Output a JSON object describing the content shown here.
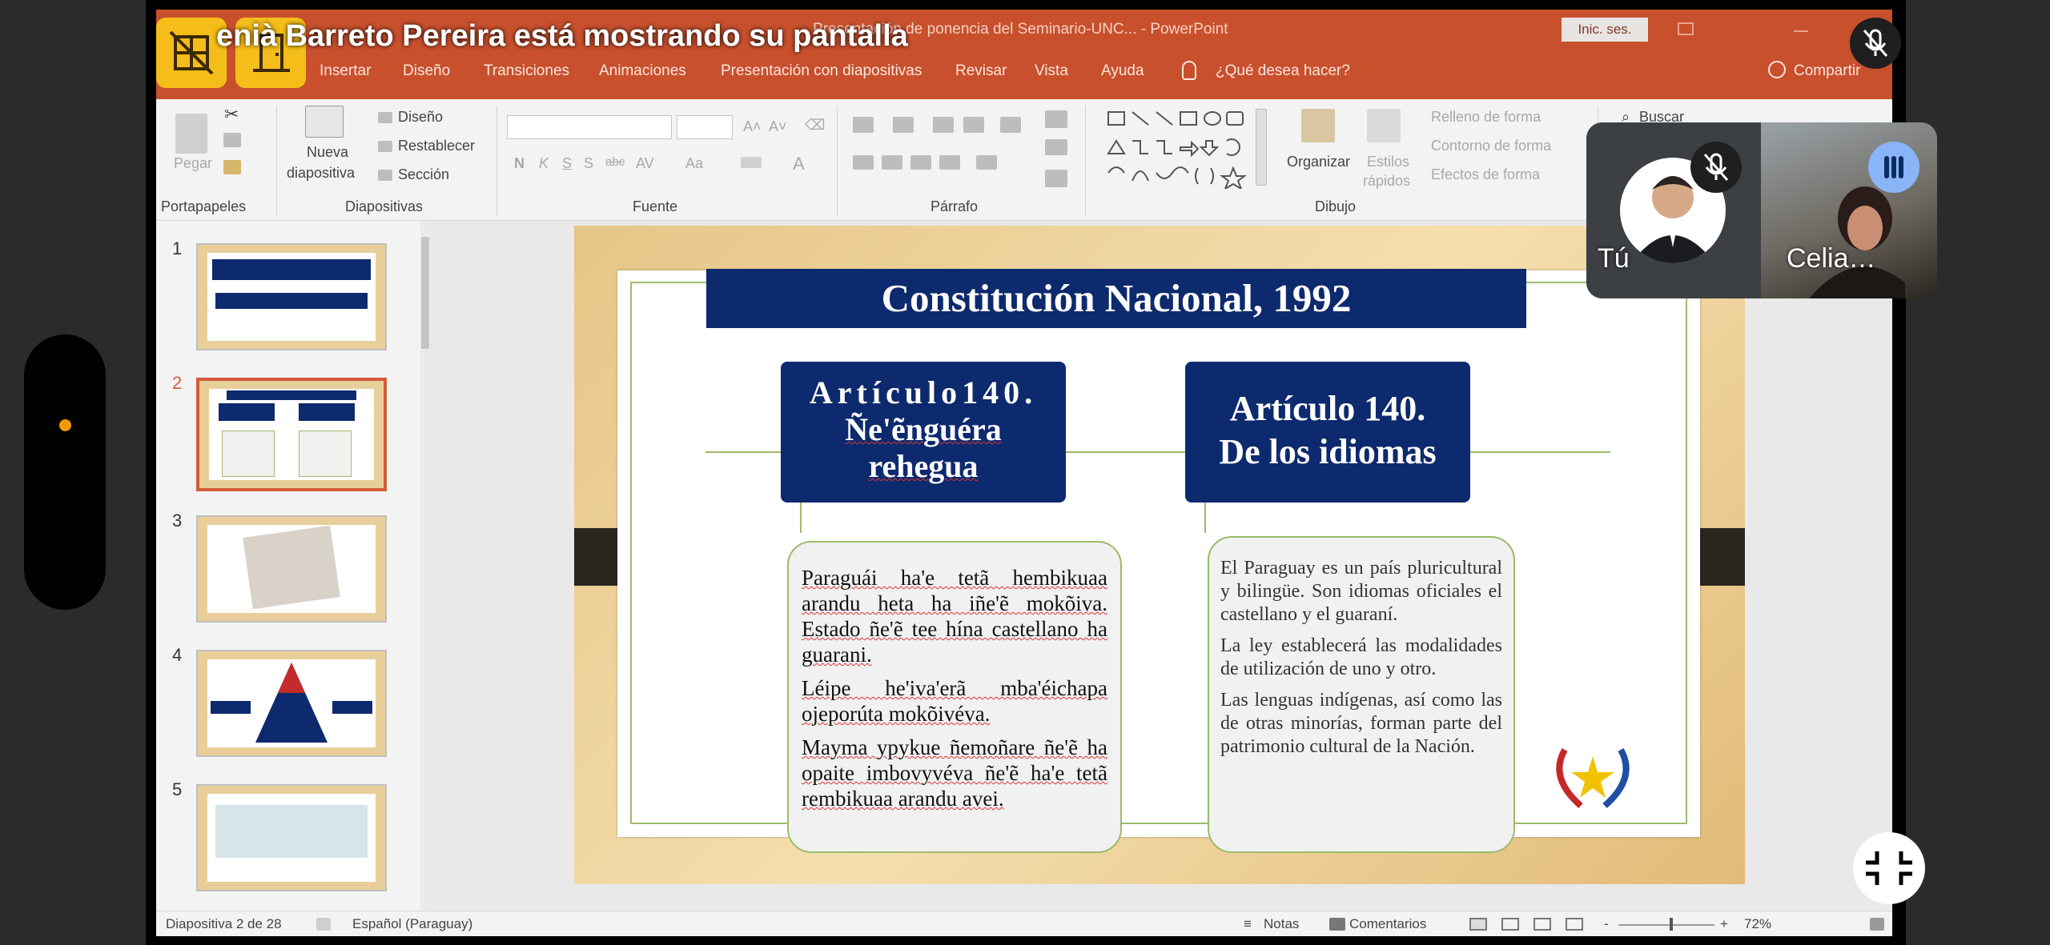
{
  "meeting": {
    "banner_text": "enià Barreto Pereira está mostrando su pantalla",
    "tiles": [
      {
        "name": "Tú",
        "muted": true
      },
      {
        "name": "Celia…",
        "speaking": true
      }
    ]
  },
  "powerpoint": {
    "document_title": "Presentación de ponencia del Seminario-UNC... - PowerPoint",
    "signin_label": "Inic. ses.",
    "tabs": [
      "Insertar",
      "Diseño",
      "Transiciones",
      "Animaciones",
      "Presentación con diapositivas",
      "Revisar",
      "Vista",
      "Ayuda"
    ],
    "tell_me": "¿Qué desea hacer?",
    "share_label": "Compartir",
    "ribbon": {
      "portapapeles": {
        "label": "Portapapeles",
        "paste": "Pegar"
      },
      "diapositivas": {
        "label": "Diapositivas",
        "new_slide_1": "Nueva",
        "new_slide_2": "diapositiva",
        "layout": "Diseño",
        "reset": "Restablecer",
        "section": "Sección"
      },
      "fuente": {
        "label": "Fuente",
        "bold": "N",
        "italic": "K",
        "underline": "S",
        "strike": "S",
        "abc": "abc",
        "av": "AV",
        "aa": "Aa",
        "a": "A"
      },
      "parrafo": {
        "label": "Párrafo"
      },
      "dibujo": {
        "label": "Dibujo",
        "arrange": "Organizar",
        "styles_1": "Estilos",
        "styles_2": "rápidos",
        "fill": "Relleno de forma",
        "outline": "Contorno de forma",
        "effects": "Efectos de forma"
      },
      "buscar": "Buscar"
    },
    "thumbnails": [
      {
        "num": "1"
      },
      {
        "num": "2",
        "selected": true
      },
      {
        "num": "3"
      },
      {
        "num": "4"
      },
      {
        "num": "5"
      }
    ],
    "slide": {
      "title": "Constitución Nacional, 1992",
      "left_heading": [
        "Artículo140.",
        "Ñe'ẽnguéra",
        "rehegua"
      ],
      "right_heading": [
        "Artículo 140.",
        "De los idiomas"
      ],
      "left_paragraphs": [
        "Paraguái ha'e tetã hembikuaa arandu heta ha iñe'ẽ mokõiva. Estado ñe'ẽ tee hína castellano ha guarani.",
        "Léipe he'iva'erã mba'éichapa ojeporúta mokõivéva.",
        "Mayma ypykue ñemoñare ñe'ẽ ha opaite imbovyvéva ñe'ẽ ha'e tetã rembikuaa arandu avei."
      ],
      "right_paragraphs": [
        "El Paraguay es un país pluricultural y bilingüe. Son idiomas oficiales el castellano y el guaraní.",
        "La ley establecerá las modalidades de utilización de uno y otro.",
        "Las lenguas indígenas, así como las de otras minorías, forman parte del patrimonio cultural de la Nación."
      ]
    },
    "status": {
      "slide_of": "Diapositiva 2 de 28",
      "language": "Español (Paraguay)",
      "notes": "Notas",
      "comments": "Comentarios",
      "zoom_minus": "-",
      "zoom_plus": "+",
      "zoom": "72%"
    }
  },
  "colors": {
    "ppt_accent": "#c8502d",
    "slide_navy": "#0d2a6e",
    "slide_green": "#9cbb6a",
    "meet_yellow": "#f5bd19",
    "dot_orange": "#f29900",
    "speaking_blue": "#8ab4f8"
  }
}
